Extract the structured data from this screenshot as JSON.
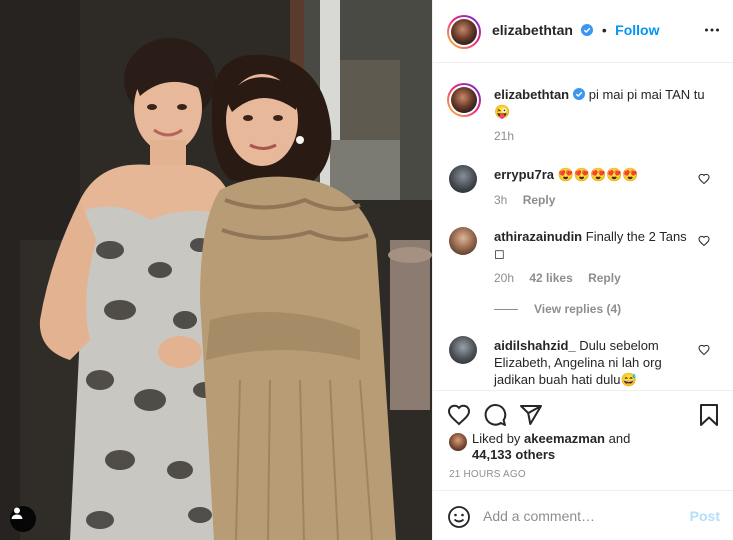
{
  "post": {
    "username": "elizabethtan",
    "separator": "•",
    "follow_label": "Follow",
    "caption_text": "pi mai pi mai TAN tu 😜",
    "caption_time": "21h"
  },
  "comments": [
    {
      "username": "errypu7ra",
      "text": "😍😍😍😍😍",
      "time": "3h",
      "reply_label": "Reply"
    },
    {
      "username": "athirazainudin",
      "text": "Finally the 2 Tans ◻",
      "time": "20h",
      "likes": "42 likes",
      "reply_label": "Reply",
      "view_replies": "View replies (4)"
    },
    {
      "username": "aidilshahzid_",
      "text": "Dulu sebelom Elizabeth, Angelina ni lah org jadikan buah hati dulu😅"
    }
  ],
  "likes": {
    "prefix": "Liked by",
    "user": "akeemazman",
    "conjunction": "and",
    "others": "44,133 others"
  },
  "timestamp": "21 HOURS AGO",
  "add_comment": {
    "placeholder": "Add a comment…",
    "post_label": "Post"
  },
  "icons": {
    "verified": "verified-badge-icon",
    "more": "more-options-icon",
    "heart": "heart-icon",
    "comment": "comment-icon",
    "share": "share-icon",
    "save": "bookmark-icon",
    "emoji": "emoji-icon",
    "tag": "user-tag-icon"
  },
  "colors": {
    "accent": "#0095f6",
    "verified": "#3897f0",
    "muted": "#8e8e8e",
    "post_disabled": "#b2dffc"
  }
}
